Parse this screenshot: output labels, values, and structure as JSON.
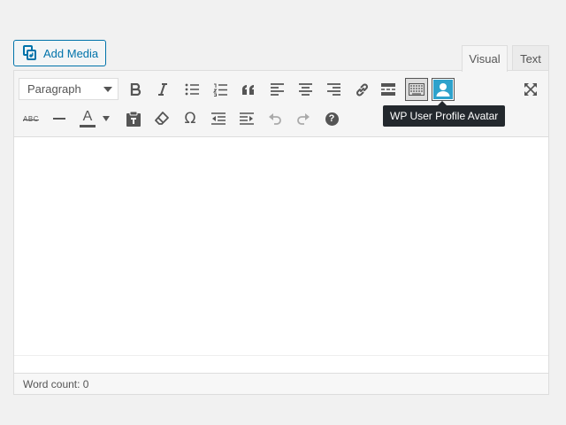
{
  "add_media": {
    "label": "Add Media",
    "icon": "add-media-icon",
    "color": "#0073aa"
  },
  "tabs": [
    {
      "label": "Visual",
      "active": true
    },
    {
      "label": "Text",
      "active": false
    }
  ],
  "toolbar": {
    "format_select": {
      "value": "Paragraph"
    },
    "row1": [
      "bold-icon",
      "italic-icon",
      "bulleted-list-icon",
      "numbered-list-icon",
      "blockquote-icon",
      "align-left-icon",
      "align-center-icon",
      "align-right-icon",
      "insert-link-icon",
      "read-more-icon",
      "toolbar-toggle-icon",
      "user-avatar-icon",
      "fullscreen-icon"
    ],
    "row2": [
      "strikethrough-icon",
      "horizontal-line-icon",
      "text-color-icon",
      "paste-as-text-icon",
      "clear-formatting-icon",
      "special-character-icon",
      "outdent-icon",
      "indent-icon",
      "undo-icon",
      "redo-icon",
      "help-icon"
    ],
    "strikethrough_glyph": "ABC",
    "text_color_glyph": "A",
    "special_char_glyph": "Ω",
    "help_glyph": "?"
  },
  "tooltip": {
    "text": "WP User Profile Avatar"
  },
  "status_bar": {
    "word_count": "Word count: 0"
  },
  "colors": {
    "accent": "#0073aa",
    "avatar_button": "#2ea2cc",
    "tooltip_bg": "#23282d"
  }
}
